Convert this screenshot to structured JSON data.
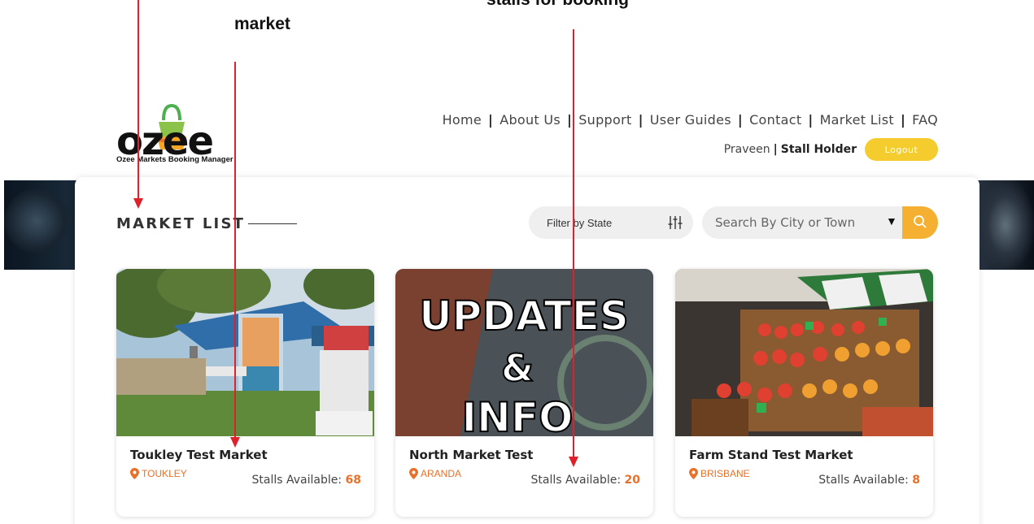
{
  "annotations": {
    "top": "stalls for booking",
    "market": "market"
  },
  "logo": {
    "text": "ozee",
    "tagline": "Ozee Markets Booking Manager"
  },
  "nav": {
    "items": [
      "Home",
      "About Us",
      "Support",
      "User Guides",
      "Contact",
      "Market List",
      "FAQ"
    ]
  },
  "user": {
    "name": "Praveen",
    "separator": "|",
    "role": "Stall Holder",
    "logout_label": "Logout"
  },
  "section": {
    "title": "MARKET LIST"
  },
  "filter": {
    "label": "Filter by State",
    "icon": "sliders-icon"
  },
  "search": {
    "placeholder": "Search By City or Town",
    "icon": "search-icon"
  },
  "colors": {
    "accent_orange": "#e8702a",
    "logout_yellow": "#f5cc2d",
    "search_btn": "#f5b032",
    "arrow_red": "#e0202a"
  },
  "markets": [
    {
      "name": "Toukley Test Market",
      "location": "TOUKLEY",
      "stalls_label": "Stalls Available:",
      "stalls": "68"
    },
    {
      "name": "North Market Test",
      "location": "ARANDA",
      "stalls_label": "Stalls Available:",
      "stalls": "20",
      "image_text_1": "UPDATES",
      "image_text_2": "&",
      "image_text_3": "INFO"
    },
    {
      "name": "Farm Stand Test Market",
      "location": "BRISBANE",
      "stalls_label": "Stalls Available:",
      "stalls": "8"
    }
  ]
}
